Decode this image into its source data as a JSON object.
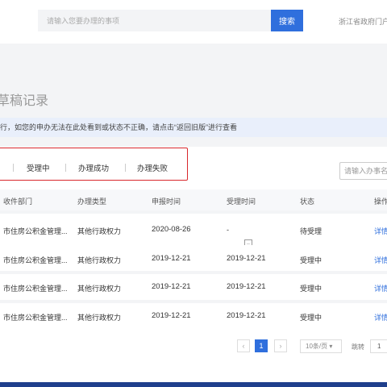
{
  "header": {
    "search_placeholder": "请输入您要办理的事项",
    "search_button": "搜索",
    "portal_link": "浙江省政府门户"
  },
  "page": {
    "title": "草稿记录",
    "notice": "行，如您的申办无法在此处看到或状态不正确，请点击“返回旧版”进行查看"
  },
  "tabs": [
    {
      "label": "受理中"
    },
    {
      "label": "办理成功"
    },
    {
      "label": "办理失败"
    }
  ],
  "filter": {
    "placeholder": "请输入办事名"
  },
  "table": {
    "headers": [
      "收件部门",
      "办理类型",
      "申报时间",
      "受理时间",
      "状态",
      "操作"
    ],
    "rows": [
      {
        "dept": "市住房公积金管理...",
        "type": "其他行政权力",
        "submit": "2020-08-26",
        "accept": "-",
        "status": "待受理",
        "action": "详情"
      },
      {
        "dept": "市住房公积金管理...",
        "type": "其他行政权力",
        "submit": "2019-12-21",
        "accept": "2019-12-21",
        "status": "受理中",
        "action": "详情"
      },
      {
        "dept": "市住房公积金管理...",
        "type": "其他行政权力",
        "submit": "2019-12-21",
        "accept": "2019-12-21",
        "status": "受理中",
        "action": "详情"
      },
      {
        "dept": "市住房公积金管理...",
        "type": "其他行政权力",
        "submit": "2019-12-21",
        "accept": "2019-12-21",
        "status": "受理中",
        "action": "详情"
      }
    ]
  },
  "pagination": {
    "prev": "‹",
    "current": "1",
    "next": "›",
    "page_size": "10条/页 ▾",
    "jump_label": "跳转",
    "jump_value": "1"
  },
  "colors": {
    "accent": "#2f6fdd",
    "highlight_box": "#d9272c",
    "footer": "#1f3f8c"
  }
}
